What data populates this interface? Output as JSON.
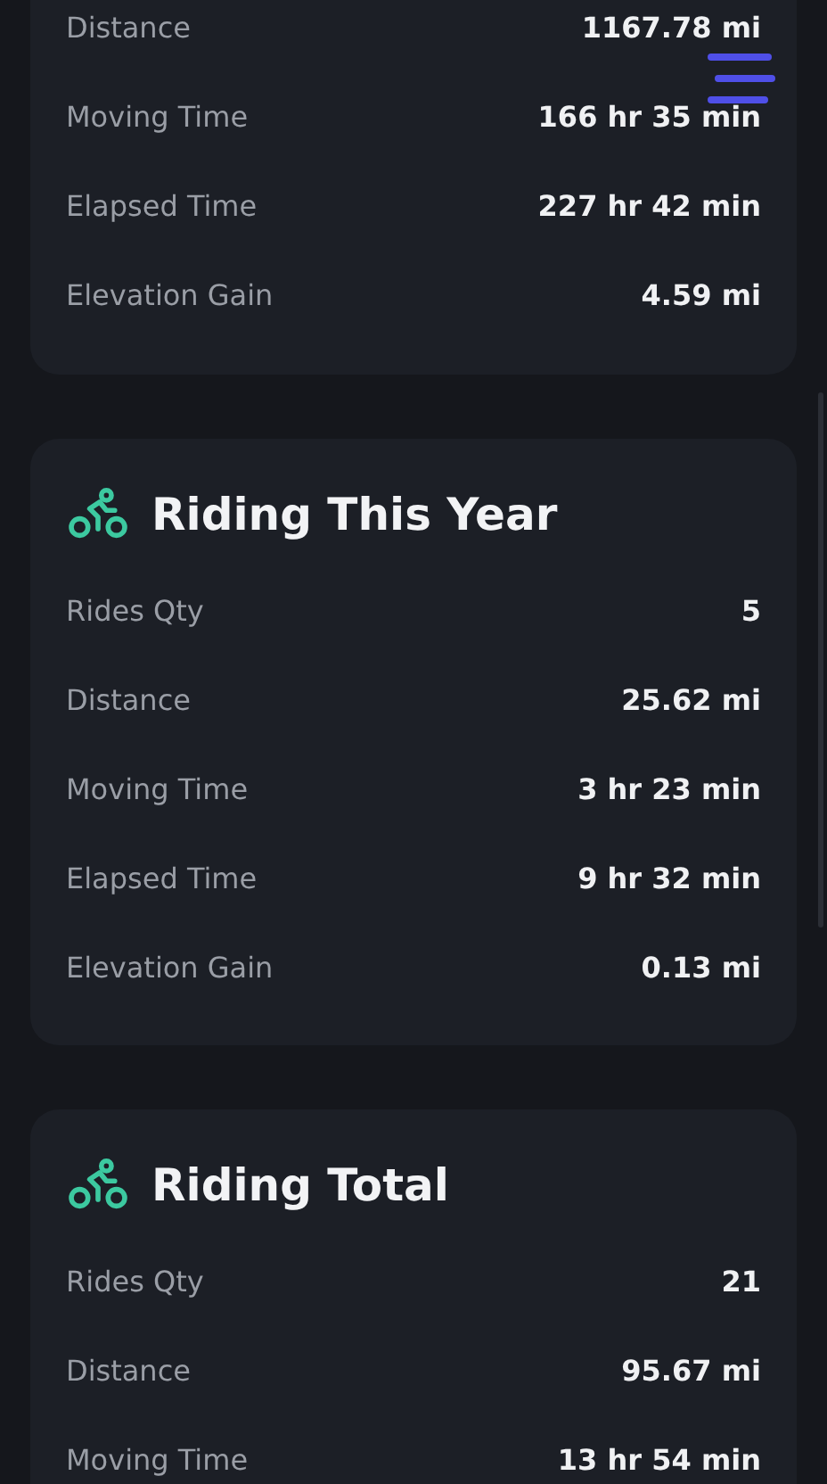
{
  "cards": [
    {
      "rows": [
        {
          "label": "Distance",
          "value": "1167.78 mi"
        },
        {
          "label": "Moving Time",
          "value": "166 hr 35 min"
        },
        {
          "label": "Elapsed Time",
          "value": "227 hr 42 min"
        },
        {
          "label": "Elevation Gain",
          "value": "4.59 mi"
        }
      ]
    },
    {
      "title": "Riding This Year",
      "rows": [
        {
          "label": "Rides Qty",
          "value": "5"
        },
        {
          "label": "Distance",
          "value": "25.62 mi"
        },
        {
          "label": "Moving Time",
          "value": "3 hr 23 min"
        },
        {
          "label": "Elapsed Time",
          "value": "9 hr 32 min"
        },
        {
          "label": "Elevation Gain",
          "value": "0.13 mi"
        }
      ]
    },
    {
      "title": "Riding Total",
      "rows": [
        {
          "label": "Rides Qty",
          "value": "21"
        },
        {
          "label": "Distance",
          "value": "95.67 mi"
        },
        {
          "label": "Moving Time",
          "value": "13 hr 54 min"
        }
      ]
    }
  ]
}
